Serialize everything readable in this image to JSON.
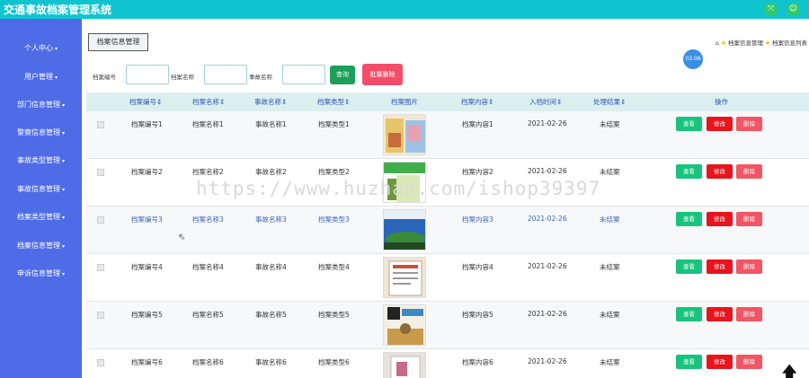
{
  "app": {
    "title": "交通事故档案管理系统"
  },
  "top_icons": [
    {
      "icon": "expand-icon",
      "glyph": "⤧"
    },
    {
      "icon": "user-icon",
      "glyph": "☺"
    }
  ],
  "sidebar": {
    "items": [
      {
        "label": "个人中心"
      },
      {
        "label": "用户管理"
      },
      {
        "label": "部门信息管理"
      },
      {
        "label": "警察信息管理"
      },
      {
        "label": "事故类型管理"
      },
      {
        "label": "事故信息管理"
      },
      {
        "label": "档案类型管理"
      },
      {
        "label": "档案信息管理"
      },
      {
        "label": "申诉信息管理"
      }
    ]
  },
  "tab": {
    "label": "档案信息管理"
  },
  "breadcrumb": {
    "home_icon": "⌂",
    "item1": "档案信息管理",
    "item2": "档案信息列表"
  },
  "timer": "03:06",
  "search": {
    "fields": [
      {
        "label": "档案编号",
        "value": ""
      },
      {
        "label": "档案名称",
        "value": ""
      },
      {
        "label": "事故名称",
        "value": ""
      }
    ],
    "search_button": "查询",
    "batch_delete_button": "批量删除"
  },
  "table": {
    "columns": [
      "档案编号",
      "档案名称",
      "事故名称",
      "档案类型",
      "档案图片",
      "档案内容",
      "入档时间",
      "处理结果",
      "操作"
    ],
    "rows": [
      {
        "code": "档案编号1",
        "name": "档案名称1",
        "accident": "事故名称1",
        "type": "档案类型1",
        "content": "档案内容1",
        "date": "2021-02-26",
        "result": "未结案"
      },
      {
        "code": "档案编号2",
        "name": "档案名称2",
        "accident": "事故名称2",
        "type": "档案类型2",
        "content": "档案内容2",
        "date": "2021-02-26",
        "result": "未结案"
      },
      {
        "code": "档案编号3",
        "name": "档案名称3",
        "accident": "事故名称3",
        "type": "档案类型3",
        "content": "档案内容3",
        "date": "2021-02-26",
        "result": "未结案"
      },
      {
        "code": "档案编号4",
        "name": "档案名称4",
        "accident": "事故名称4",
        "type": "档案类型4",
        "content": "档案内容4",
        "date": "2021-02-26",
        "result": "未结案"
      },
      {
        "code": "档案编号5",
        "name": "档案名称5",
        "accident": "事故名称5",
        "type": "档案类型5",
        "content": "档案内容5",
        "date": "2021-02-26",
        "result": "未结案"
      },
      {
        "code": "档案编号6",
        "name": "档案名称6",
        "accident": "事故名称6",
        "type": "档案类型6",
        "content": "档案内容6",
        "date": "2021-02-26",
        "result": "未结案"
      }
    ],
    "actions": {
      "view": "查看",
      "edit": "修改",
      "delete": "删除"
    }
  },
  "watermark": "https://www.huzhan.com/ishop39397",
  "back_to_top_glyph": "🡅"
}
